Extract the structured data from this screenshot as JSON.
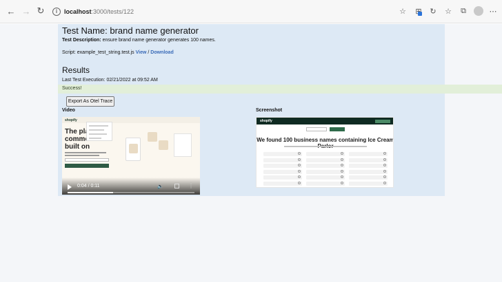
{
  "browser": {
    "url_host": "localhost",
    "url_path": ":3000/tests/122"
  },
  "test": {
    "name_label": "Test Name: brand name generator",
    "description_label": "Test Description:",
    "description_value": " ensure brand name generator generates 100 names.",
    "script_label": "Script: example_test_string.test.js ",
    "view_link": "View",
    "separator": " / ",
    "download_link": "Download"
  },
  "results": {
    "heading": "Results",
    "last_execution": "Last Test Execution: 02/21/2022 at 09:52 AM",
    "status": "Success!",
    "export_button": "Export As Otel Trace"
  },
  "video": {
    "label": "Video",
    "time": "0:04 / 0:11",
    "progress": 0.36,
    "preview_logo": "shopify",
    "preview_headline": "The plat\ncomme\nbuilt on"
  },
  "screenshot": {
    "label": "Screenshot",
    "preview_logo": "shopify",
    "preview_heading": "We found 100 business names containing Ice Cream Parlor"
  },
  "icons": {
    "back": "←",
    "forward": "→",
    "reload": "↻",
    "info": "i",
    "star": "☆",
    "ext": "⊞",
    "refresh2": "↻",
    "favorites": "☆",
    "collections": "⧉",
    "more": "⋯"
  }
}
